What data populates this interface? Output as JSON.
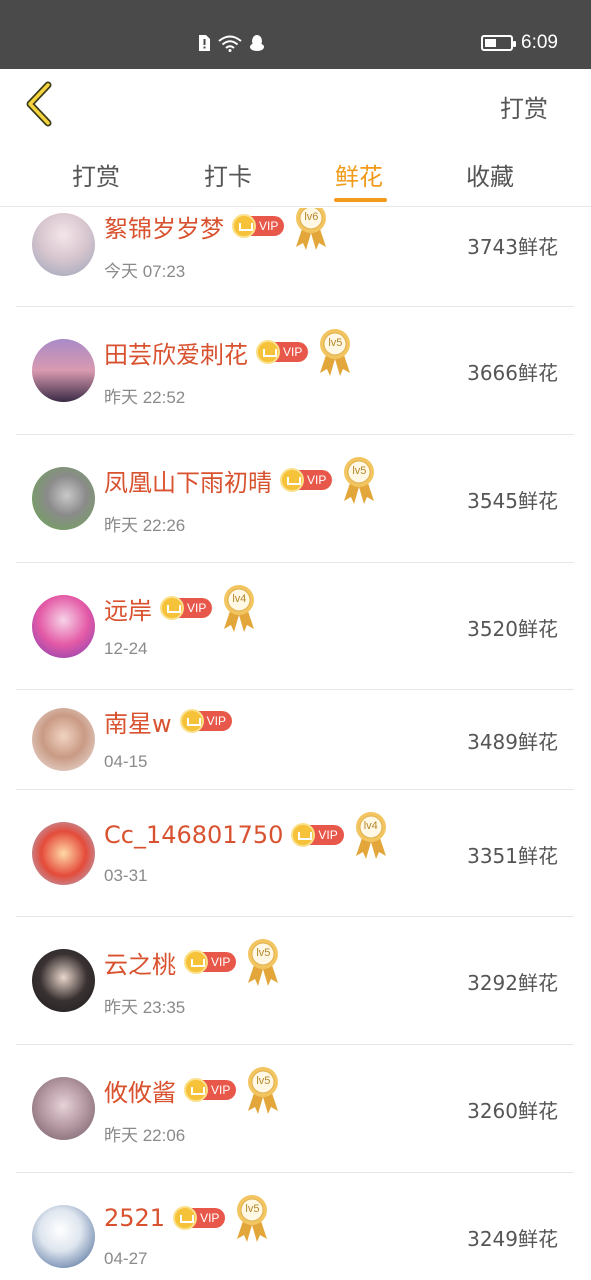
{
  "status_bar": {
    "time": "6:09",
    "icons": [
      "sim-alert-icon",
      "wifi-icon",
      "qq-icon"
    ],
    "battery_level": 0.45
  },
  "header": {
    "back_icon": "chevron-left-icon",
    "action_label": "打赏"
  },
  "tabs": [
    {
      "label": "打赏",
      "active": false
    },
    {
      "label": "打卡",
      "active": false
    },
    {
      "label": "鲜花",
      "active": true
    },
    {
      "label": "收藏",
      "active": false
    }
  ],
  "accent_color": "#f29a1a",
  "name_color": "#d9522f",
  "list": [
    {
      "name": "絮锦岁岁梦",
      "vip": "VIP",
      "level": "lv6",
      "time": "今天 07:23",
      "count": "3743鲜花"
    },
    {
      "name": "田芸欣爱刺花",
      "vip": "VIP",
      "level": "lv5",
      "time": "昨天 22:52",
      "count": "3666鲜花"
    },
    {
      "name": "凤凰山下雨初晴",
      "vip": "VIP",
      "level": "lv5",
      "time": "昨天 22:26",
      "count": "3545鲜花"
    },
    {
      "name": "远岸",
      "vip": "VIP",
      "level": "lv4",
      "time": "12-24",
      "count": "3520鲜花"
    },
    {
      "name": "南星w",
      "vip": "VIP",
      "level": "",
      "time": "04-15",
      "count": "3489鲜花"
    },
    {
      "name": "Cc_146801750",
      "vip": "VIP",
      "level": "lv4",
      "time": "03-31",
      "count": "3351鲜花"
    },
    {
      "name": "云之桃",
      "vip": "VIP",
      "level": "lv5",
      "time": "昨天 23:35",
      "count": "3292鲜花"
    },
    {
      "name": "攸攸酱",
      "vip": "VIP",
      "level": "lv5",
      "time": "昨天 22:06",
      "count": "3260鲜花"
    },
    {
      "name": "2521",
      "vip": "VIP",
      "level": "lv5",
      "time": "04-27",
      "count": "3249鲜花"
    }
  ]
}
